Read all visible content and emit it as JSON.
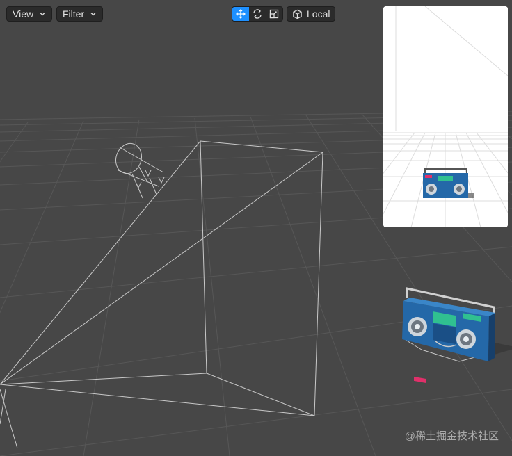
{
  "toolbar": {
    "view_label": "View",
    "filter_label": "Filter",
    "local_label": "Local",
    "tools": [
      {
        "name": "move-tool",
        "icon": "move-arrows-icon",
        "active": true
      },
      {
        "name": "rotate-tool",
        "icon": "rotate-icon",
        "active": false
      },
      {
        "name": "scale-tool",
        "icon": "scale-icon",
        "active": false
      }
    ]
  },
  "preview": {
    "label": "camera-preview",
    "subject_icon": "boombox"
  },
  "scene": {
    "objects": [
      "camera-frustum",
      "spotlight",
      "boombox"
    ]
  },
  "watermark": "@稀土掘金技术社区",
  "colors": {
    "viewport_bg": "#474747",
    "grid": "#5a5a5a",
    "wireframe": "#c8c8c8",
    "toolbar_bg": "#2b2b2b",
    "active_tool": "#1e90ff",
    "boombox_body": "#2a6fa8",
    "boombox_accent": "#e0306a",
    "boombox_green": "#30c090"
  }
}
